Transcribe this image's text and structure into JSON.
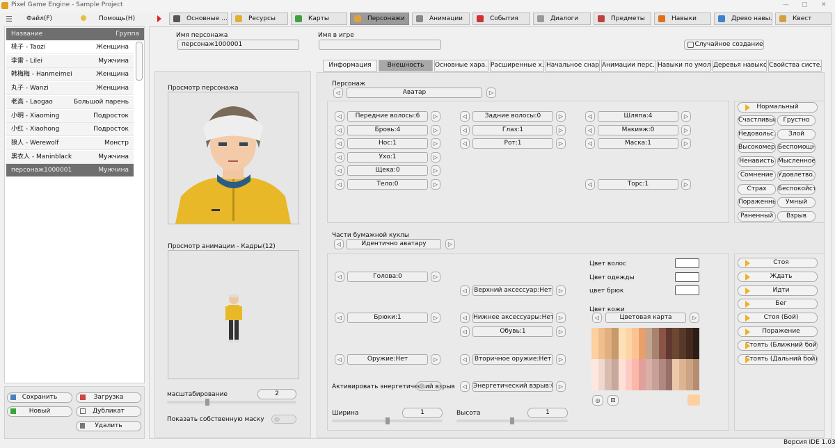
{
  "window": {
    "title": "Pixel Game Engine - Sample Project",
    "version": "Версия IDE 1.03"
  },
  "menu": {
    "file": "Файл(F)",
    "help": "Помощь(H)"
  },
  "tabs": [
    "Основные ...",
    "Ресурсы",
    "Карты",
    "Персонажи",
    "Анимации",
    "События",
    "Диалоги",
    "Предметы",
    "Навыки",
    "Древо навы...",
    "Квест"
  ],
  "active_tab": "Персонажи",
  "list": {
    "col_name": "Название",
    "col_group": "Группа",
    "rows": [
      {
        "name": "桃子 - Taozi",
        "group": "Женщина"
      },
      {
        "name": "李雷 - Lilei",
        "group": "Мужчина"
      },
      {
        "name": "韩梅梅 - Hanmeimei",
        "group": "Женщина"
      },
      {
        "name": "丸子 - Wanzi",
        "group": "Женщина"
      },
      {
        "name": "老高 - Laogao",
        "group": "Большой парень"
      },
      {
        "name": "小明 - Xiaoming",
        "group": "Подросток"
      },
      {
        "name": "小红 - Xiaohong",
        "group": "Подросток"
      },
      {
        "name": "狼人 - Werewolf",
        "group": "Монстр"
      },
      {
        "name": "黑衣人 - Maninblack",
        "group": "Мужчина"
      },
      {
        "name": "персонаж1000001",
        "group": "Мужчина"
      }
    ]
  },
  "actions": {
    "save": "Сохранить",
    "load": "Загрузка",
    "new": "Новый",
    "duplicate": "Дубликат",
    "delete": "Удалить"
  },
  "header": {
    "char_name_label": "Имя персонажа",
    "char_name": "персонаж1000001",
    "game_name_label": "Имя в игре",
    "game_name": "",
    "random": "Случайное создание"
  },
  "preview": {
    "char_label": "Просмотр персонажа",
    "anim_label": "Просмотр анимации - Кадры(12)",
    "scale_label": "масштабирование",
    "scale": "2",
    "mask_label": "Показать собственную маску",
    "mask_on": false
  },
  "subtabs": [
    "Информация",
    "Внешность",
    "Основные хара...",
    "Расширенные х...",
    "Начальное снар...",
    "Анимации перс...",
    "Навыки по умол...",
    "Деревья навыков",
    "Свойства систе..."
  ],
  "active_subtab": "Внешность",
  "appearance": {
    "section": "Персонаж",
    "mode": "Аватар",
    "parts": [
      "Передние волосы:6",
      "Задние волосы:0",
      "Шляпа:4",
      "Бровь:4",
      "Глаз:1",
      "Макияж:0",
      "Нос:1",
      "Рот:1",
      "Маска:1",
      "Ухо:1",
      "Щека:0",
      "Тело:0",
      "Торс:1"
    ],
    "emotions": [
      "Нормальный",
      "Счастливый",
      "Грустно",
      "Недовольс...",
      "Злой",
      "Высокомер...",
      "Беспомощн...",
      "Ненависть",
      "Мысленное...",
      "Сомнение",
      "Удовлетво...",
      "Страх",
      "Беспокойст...",
      "Пораженный",
      "Умный",
      "Раненный",
      "Взрыв"
    ]
  },
  "paperdoll": {
    "section": "Части бумажной куклы",
    "mode": "Идентично аватару",
    "parts": [
      "Голова:0",
      "Верхний аксессуар:Нет",
      "Брюки:1",
      "Нижнее аксессуары:Нет",
      "Обувь:1",
      "Оружие:Нет",
      "Вторичное оружие:Нет",
      "Энергетический взрыв:0"
    ],
    "energy_label": "Активировать энергетический взрыв",
    "width_label": "Ширина",
    "width": "1",
    "height_label": "Высота",
    "height": "1",
    "hair_color": "Цвет волос",
    "clothes_color": "Цвет одежды",
    "pants_color": "цвет брюк",
    "skin_label": "Цвет кожи",
    "skin_mode": "Цветовая карта",
    "skin_selected": "#fdd0a0",
    "palette": [
      [
        "#fdd0a0",
        "#f0bd8c",
        "#e2b080",
        "#c79a6c",
        "#fde0b8",
        "#fdd5a5",
        "#fbc394",
        "#e8a06a",
        "#c4a690",
        "#a88470",
        "#8c5446",
        "#603830",
        "#6c4832",
        "#583828",
        "#442a1e",
        "#2a1e16"
      ],
      [
        "#fde8e0",
        "#f0d8d0",
        "#d8bcb0",
        "#c8a89c",
        "#fee0d8",
        "#fdcac4",
        "#fbb8a8",
        "#e0a09c",
        "#d8b0a8",
        "#c8a098",
        "#b08880",
        "#987068",
        "#ecc8a8",
        "#dcb490",
        "#cca484",
        "#b48c70"
      ]
    ],
    "anims": [
      "Стоя",
      "Ждать",
      "Идти",
      "Бег",
      "Стоя (Бой)",
      "Поражение",
      "Стоять (Ближний бой)",
      "Стоять (Дальний бой)"
    ]
  }
}
